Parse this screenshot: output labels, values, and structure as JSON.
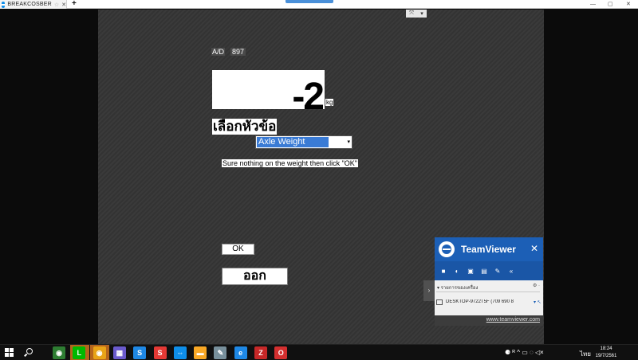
{
  "browser": {
    "tab_title": "BREAKCOSBER",
    "new_tab": "+",
    "win_min": "—",
    "win_max": "▢",
    "win_close": "✕"
  },
  "remote_ctrl": {
    "expand": "⤧",
    "chevron": "▾"
  },
  "app": {
    "ad_label": "A/D",
    "ad_value": "897",
    "weight_value": "-2",
    "unit": "kg",
    "choose_topic": "เลือกหัวข้อ",
    "select_value": "Axle Weight",
    "select_arrow": "▾",
    "instruction": "Sure nothing on the weight then click \"OK\"",
    "ok_label": "OK",
    "exit_label": "ออก"
  },
  "teamviewer": {
    "title": "TeamViewer",
    "close": "✕",
    "side_arrow": "›",
    "section": "▾ รายการของเครื่อง",
    "section_gear": "⚙ ·",
    "device_name": "DESKTOP-9722T5F (709 690 8",
    "device_arrow": "▾ ↖",
    "link": "www.teamviewer.com",
    "tools": [
      "■",
      "◐",
      "▣",
      "▤",
      "✎",
      "«"
    ]
  },
  "taskbar": {
    "tray_lang": "ไทย",
    "clock_time": "18:24",
    "clock_date": "19/7/2561",
    "tray_icons": "⚈  ᴿ  ^  ▭  ◌  ◁×",
    "apps": [
      {
        "name": "chrome-multi",
        "label": "◉",
        "color": "#2e7d32"
      },
      {
        "name": "line",
        "label": "L",
        "color": "#00b900"
      },
      {
        "name": "chrome",
        "label": "◉",
        "color": "#e8a317"
      },
      {
        "name": "store",
        "label": "▦",
        "color": "#6a5acd"
      },
      {
        "name": "s-blue",
        "label": "S",
        "color": "#1e88e5"
      },
      {
        "name": "s-red",
        "label": "S",
        "color": "#e53935"
      },
      {
        "name": "teamviewer",
        "label": "⇔",
        "color": "#0e8ee9"
      },
      {
        "name": "file-explorer",
        "label": "▬",
        "color": "#f9a825"
      },
      {
        "name": "notepad",
        "label": "✎",
        "color": "#78909c"
      },
      {
        "name": "edge",
        "label": "e",
        "color": "#1e88e5"
      },
      {
        "name": "filezilla",
        "label": "Z",
        "color": "#c62828"
      },
      {
        "name": "opera",
        "label": "O",
        "color": "#d32f2f"
      }
    ]
  }
}
